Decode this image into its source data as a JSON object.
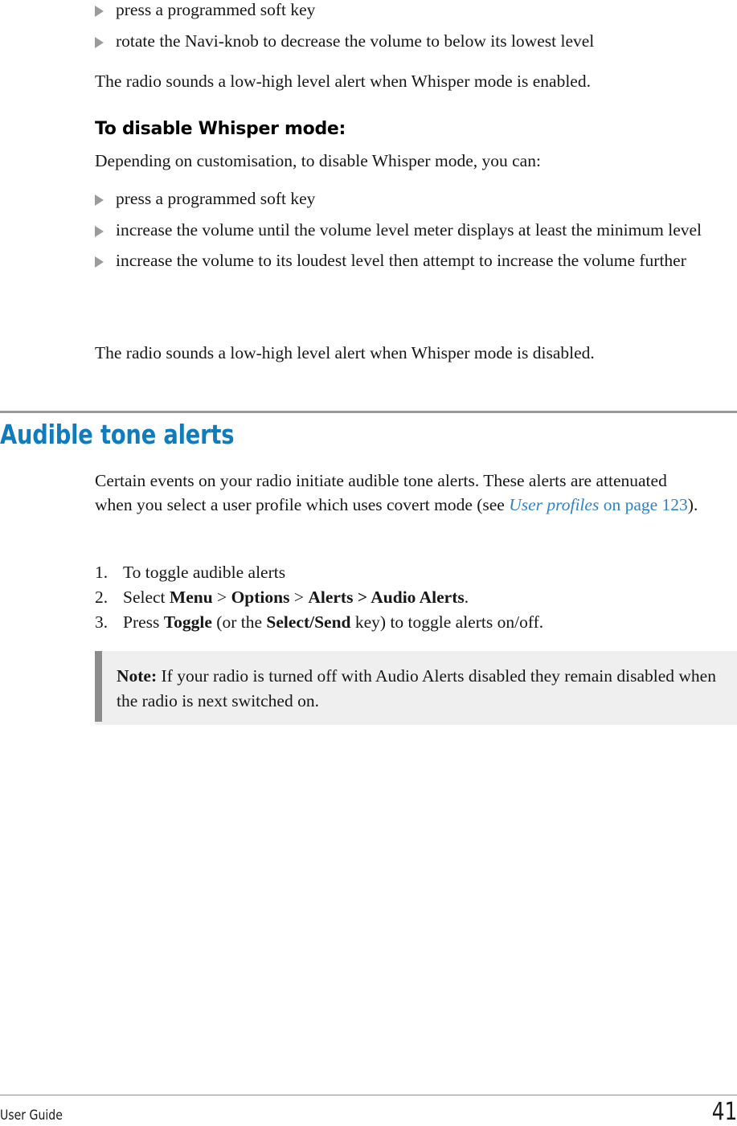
{
  "colors": {
    "heading_blue": "#0f7cc0",
    "link_blue": "#2f82c9",
    "rule_gray": "#9a9a9a",
    "note_bar_gray": "#8c8c8c",
    "note_bg_gray": "#efefef",
    "bullet_gray": "#9b9b9b",
    "text_black": "#171717"
  },
  "top_section": {
    "bullets": [
      "press a programmed soft key",
      "rotate the Navi-knob to decrease the volume to below its lowest level"
    ],
    "paragraph": "The radio sounds a low-high level alert when Whisper mode is enabled."
  },
  "disable_section": {
    "heading": "To disable Whisper mode:",
    "intro": "Depending on customisation, to disable Whisper mode, you can:",
    "bullets": [
      "press a programmed soft key",
      "increase the volume until the volume level meter displays at least the minimum level",
      "increase the volume to its loudest level then attempt to increase the volume further"
    ],
    "paragraph": "The radio sounds a low-high level alert when Whisper mode is disabled."
  },
  "audible_section": {
    "heading": "Audible tone alerts",
    "paragraph": {
      "before_link": "Certain events on your radio initiate audible tone alerts. These alerts are attenuated when you select a user profile which uses covert mode (see ",
      "link_italic": "User profiles",
      "link_rest": " on page 123",
      "after_link": ")."
    },
    "steps": [
      {
        "number": "1.",
        "parts": [
          {
            "text": "To toggle audible alerts",
            "bold": false
          }
        ]
      },
      {
        "number": "2.",
        "parts": [
          {
            "text": "Select ",
            "bold": false
          },
          {
            "text": "Menu",
            "bold": true
          },
          {
            "text": " > ",
            "bold": false
          },
          {
            "text": "Options",
            "bold": true
          },
          {
            "text": " > ",
            "bold": false
          },
          {
            "text": "Alerts > Audio Alerts",
            "bold": true
          },
          {
            "text": ".",
            "bold": false
          }
        ]
      },
      {
        "number": "3.",
        "parts": [
          {
            "text": "Press ",
            "bold": false
          },
          {
            "text": "Toggle",
            "bold": true
          },
          {
            "text": " (or the ",
            "bold": false
          },
          {
            "text": "Select/Send",
            "bold": true
          },
          {
            "text": " key) to toggle alerts on/off.",
            "bold": false
          }
        ]
      }
    ],
    "note": {
      "label": "Note:",
      "text": " If your radio is turned off with Audio Alerts disabled they remain disabled when the radio is next switched on."
    }
  },
  "footer": {
    "left": "User Guide",
    "page_number": "41"
  }
}
